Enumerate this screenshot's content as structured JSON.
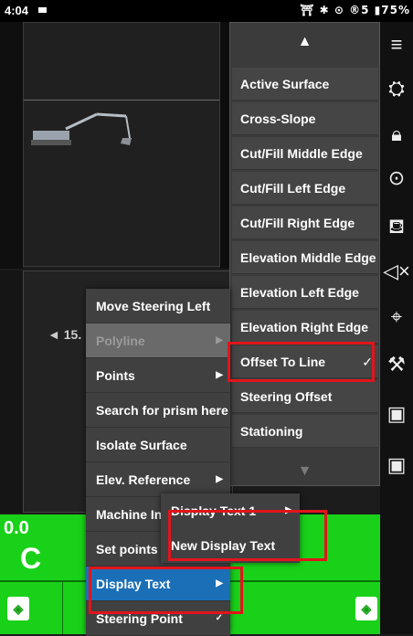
{
  "status": {
    "time": "4:04",
    "right": "⛩ ✱ ⊙ ®5 ▮75%"
  },
  "view": {
    "side_label": "◄ 15."
  },
  "green": {
    "label1": "0.0",
    "label2": "C"
  },
  "right_menu": {
    "items": [
      {
        "label": "Active Surface",
        "checked": ""
      },
      {
        "label": "Cross-Slope",
        "checked": ""
      },
      {
        "label": "Cut/Fill Middle Edge",
        "checked": ""
      },
      {
        "label": "Cut/Fill Left Edge",
        "checked": ""
      },
      {
        "label": "Cut/Fill Right Edge",
        "checked": ""
      },
      {
        "label": "Elevation Middle Edge",
        "checked": ""
      },
      {
        "label": "Elevation Left Edge",
        "checked": ""
      },
      {
        "label": "Elevation Right Edge",
        "checked": ""
      },
      {
        "label": "Offset To Line",
        "checked": "✓"
      },
      {
        "label": "Steering Offset",
        "checked": ""
      },
      {
        "label": "Stationing",
        "checked": ""
      }
    ]
  },
  "context_menu": {
    "items": [
      {
        "label": "Move Steering Left",
        "arrow": "",
        "state": "normal"
      },
      {
        "label": "Polyline",
        "arrow": "▶",
        "state": "disabled"
      },
      {
        "label": "Points",
        "arrow": "▶",
        "state": "normal"
      },
      {
        "label": "Search for prism here",
        "arrow": "",
        "state": "normal"
      },
      {
        "label": "Isolate Surface",
        "arrow": "",
        "state": "normal"
      },
      {
        "label": "Elev. Reference",
        "arrow": "▶",
        "state": "normal"
      },
      {
        "label": "Machine In",
        "arrow": "",
        "state": "normal"
      },
      {
        "label": "Set points",
        "arrow": "",
        "state": "normal"
      },
      {
        "label": "Display Text",
        "arrow": "▶",
        "state": "selected"
      },
      {
        "label": "Steering Point",
        "arrow": "✓",
        "state": "normal"
      }
    ]
  },
  "submenu": {
    "items": [
      {
        "label": "Display Text 1",
        "arrow": "▶"
      },
      {
        "label": "New Display Text",
        "arrow": ""
      }
    ]
  },
  "toolbar": {
    "icons": [
      "menu-icon",
      "surface-icon",
      "lock-rotate-icon",
      "next-icon",
      "bucket-icon",
      "mute-icon",
      "map-pin-icon",
      "excavator-icon",
      "gps-icon",
      "gps-up-icon"
    ]
  },
  "colors": {
    "green": "#19d119",
    "highlight": "#1b6fb7",
    "annotation": "#e2141c"
  }
}
